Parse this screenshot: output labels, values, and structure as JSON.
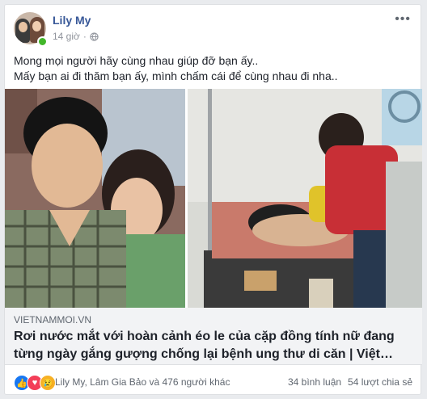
{
  "post": {
    "author": "Lily My",
    "time": "14 giờ",
    "privacy_icon": "globe-icon",
    "text_lines": [
      "Mong mọi người hãy cùng nhau giúp đỡ bạn ấy..",
      "Mấy bạn ai đi thăm bạn ấy, mình chấm cái để cùng nhau đi nha.."
    ]
  },
  "link": {
    "source": "VIETNAMMOI.VN",
    "headline": "Rơi nước mắt với hoàn cảnh éo le của cặp đồng tính nữ đang từng ngày gắng gượng chống lại bệnh ung thư di căn | Việt…"
  },
  "footer": {
    "reactions": [
      "like",
      "love",
      "sad"
    ],
    "reactors": "Lily My, Lâm Gia Bảo và 476 người khác",
    "comments": "34 bình luận",
    "shares": "54 lượt chia sẻ"
  }
}
